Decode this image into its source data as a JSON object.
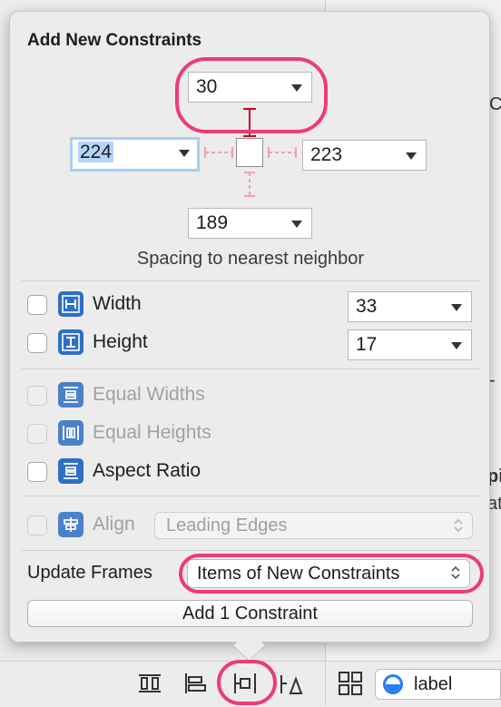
{
  "title": "Add New Constraints",
  "spacing": {
    "top": "30",
    "leading": "224",
    "trailing": "223",
    "bottom": "189",
    "caption": "Spacing to nearest neighbor"
  },
  "size_constraints": [
    {
      "label": "Width",
      "value": "33",
      "icon": "width-constraint-icon"
    },
    {
      "label": "Height",
      "value": "17",
      "icon": "height-constraint-icon"
    }
  ],
  "equal_constraints": [
    {
      "label": "Equal Widths",
      "enabled": false,
      "icon": "equal-widths-icon"
    },
    {
      "label": "Equal Heights",
      "enabled": false,
      "icon": "equal-heights-icon"
    },
    {
      "label": "Aspect Ratio",
      "enabled": true,
      "icon": "aspect-ratio-icon"
    }
  ],
  "align": {
    "label": "Align",
    "value": "Leading Edges",
    "enabled": false,
    "icon": "align-icon"
  },
  "update_frames": {
    "label": "Update Frames",
    "value": "Items of New Constraints"
  },
  "add_button": "Add 1 Constraint",
  "bottom_bar": {
    "object_selector_label": "label",
    "icons": [
      "stack-icon",
      "align-icon",
      "pin-icon",
      "resolve-issues-icon",
      "grid-icon"
    ]
  },
  "colors": {
    "annotation": "#ed3b76",
    "constraint_red": "#d0021b",
    "icon_blue": "#2f6fc4",
    "selection": "#b4d4fb"
  }
}
